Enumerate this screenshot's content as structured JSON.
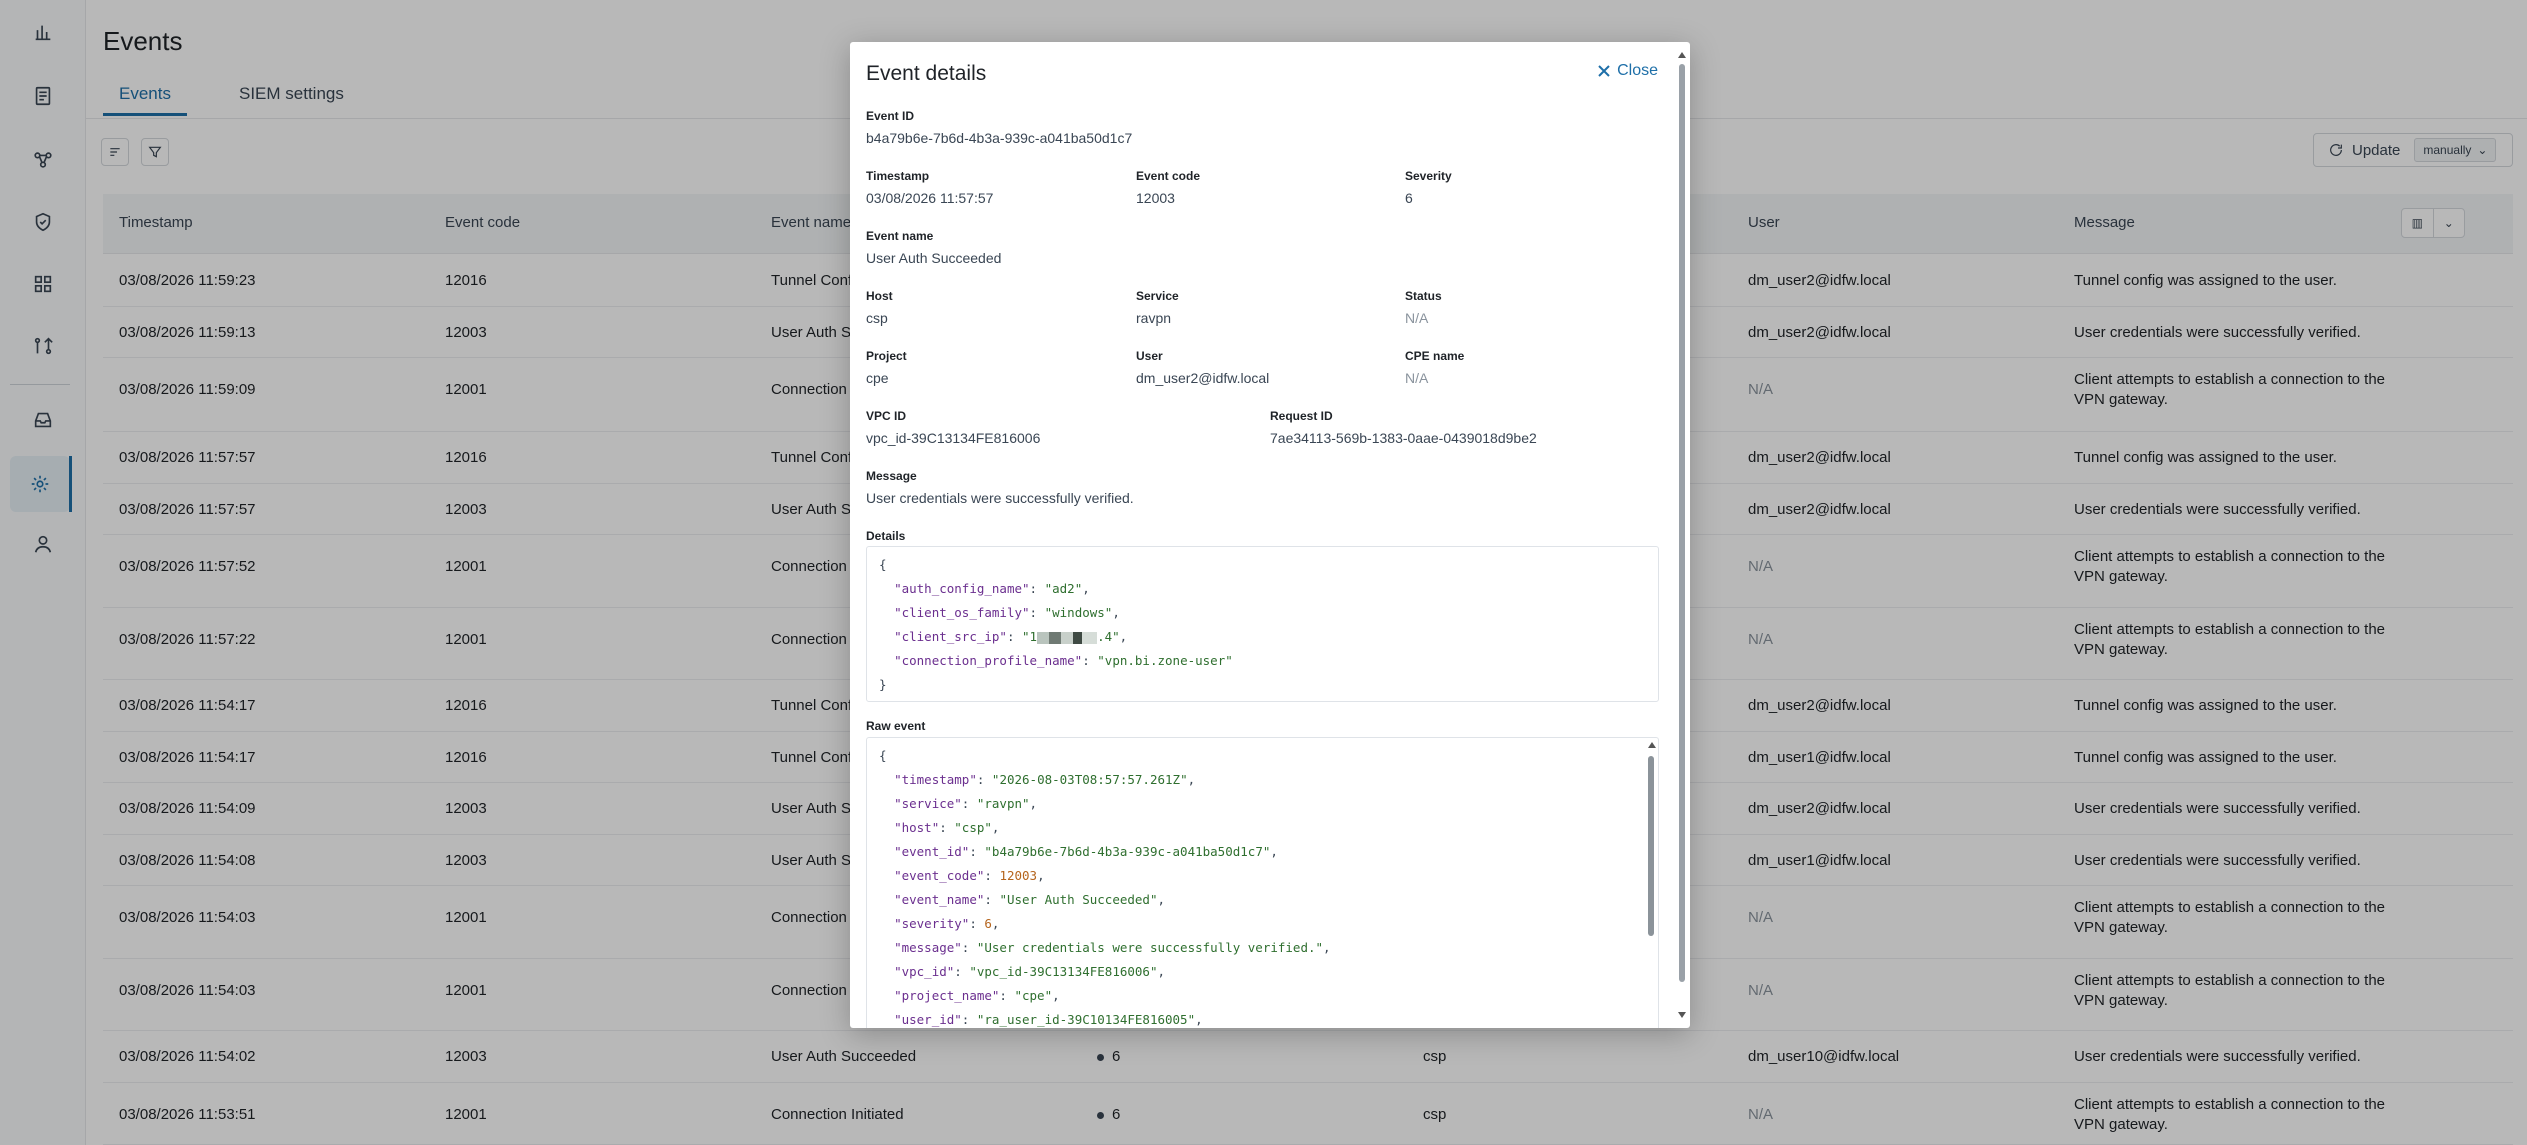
{
  "page": {
    "title": "Events",
    "tabs": [
      {
        "label": "Events",
        "active": true
      },
      {
        "label": "SIEM settings",
        "active": false
      }
    ],
    "update": {
      "label": "Update",
      "mode": "manually"
    }
  },
  "table": {
    "headers": {
      "timestamp": "Timestamp",
      "event_code": "Event code",
      "event_name": "Event name",
      "user": "User",
      "message": "Message"
    },
    "rows": [
      {
        "timestamp": "03/08/2026 11:59:23",
        "code": "12016",
        "name": "Tunnel Confi",
        "user": "dm_user2@idfw.local",
        "message": "Tunnel config was assigned to the user."
      },
      {
        "timestamp": "03/08/2026 11:59:13",
        "code": "12003",
        "name": "User Auth Su",
        "user": "dm_user2@idfw.local",
        "message": "User credentials were successfully verified."
      },
      {
        "timestamp": "03/08/2026 11:59:09",
        "code": "12001",
        "name": "Connection I",
        "user": "N/A",
        "message": "Client attempts to establish a connection to the VPN gateway."
      },
      {
        "timestamp": "03/08/2026 11:57:57",
        "code": "12016",
        "name": "Tunnel Confi",
        "user": "dm_user2@idfw.local",
        "message": "Tunnel config was assigned to the user."
      },
      {
        "timestamp": "03/08/2026 11:57:57",
        "code": "12003",
        "name": "User Auth Su",
        "user": "dm_user2@idfw.local",
        "message": "User credentials were successfully verified."
      },
      {
        "timestamp": "03/08/2026 11:57:52",
        "code": "12001",
        "name": "Connection I",
        "user": "N/A",
        "message": "Client attempts to establish a connection to the VPN gateway."
      },
      {
        "timestamp": "03/08/2026 11:57:22",
        "code": "12001",
        "name": "Connection I",
        "user": "N/A",
        "message": "Client attempts to establish a connection to the VPN gateway."
      },
      {
        "timestamp": "03/08/2026 11:54:17",
        "code": "12016",
        "name": "Tunnel Confi",
        "user": "dm_user2@idfw.local",
        "message": "Tunnel config was assigned to the user."
      },
      {
        "timestamp": "03/08/2026 11:54:17",
        "code": "12016",
        "name": "Tunnel Confi",
        "user": "dm_user1@idfw.local",
        "message": "Tunnel config was assigned to the user."
      },
      {
        "timestamp": "03/08/2026 11:54:09",
        "code": "12003",
        "name": "User Auth Su",
        "user": "dm_user2@idfw.local",
        "message": "User credentials were successfully verified."
      },
      {
        "timestamp": "03/08/2026 11:54:08",
        "code": "12003",
        "name": "User Auth Su",
        "user": "dm_user1@idfw.local",
        "message": "User credentials were successfully verified."
      },
      {
        "timestamp": "03/08/2026 11:54:03",
        "code": "12001",
        "name": "Connection I",
        "user": "N/A",
        "message": "Client attempts to establish a connection to the VPN gateway."
      },
      {
        "timestamp": "03/08/2026 11:54:03",
        "code": "12001",
        "name": "Connection I",
        "user": "N/A",
        "message": "Client attempts to establish a connection to the VPN gateway."
      },
      {
        "timestamp": "03/08/2026 11:54:02",
        "code": "12003",
        "name": "User Auth Succeeded",
        "severity": "6",
        "host": "csp",
        "user": "dm_user10@idfw.local",
        "message": "User credentials were successfully verified."
      },
      {
        "timestamp": "03/08/2026 11:53:51",
        "code": "12001",
        "name": "Connection Initiated",
        "severity": "6",
        "host": "csp",
        "user": "N/A",
        "message": "Client attempts to establish a connection to the VPN gateway."
      }
    ]
  },
  "modal": {
    "title": "Event details",
    "close_label": "Close",
    "fields": {
      "event_id": {
        "label": "Event ID",
        "value": "b4a79b6e-7b6d-4b3a-939c-a041ba50d1c7"
      },
      "timestamp": {
        "label": "Timestamp",
        "value": "03/08/2026 11:57:57"
      },
      "event_code": {
        "label": "Event code",
        "value": "12003"
      },
      "severity": {
        "label": "Severity",
        "value": "6"
      },
      "event_name": {
        "label": "Event name",
        "value": "User Auth Succeeded"
      },
      "host": {
        "label": "Host",
        "value": "csp"
      },
      "service": {
        "label": "Service",
        "value": "ravpn"
      },
      "status": {
        "label": "Status",
        "value": "N/A"
      },
      "project": {
        "label": "Project",
        "value": "cpe"
      },
      "user": {
        "label": "User",
        "value": "dm_user2@idfw.local"
      },
      "cpe_name": {
        "label": "CPE name",
        "value": "N/A"
      },
      "vpc_id": {
        "label": "VPC ID",
        "value": "vpc_id-39C13134FE816006"
      },
      "request_id": {
        "label": "Request ID",
        "value": "7ae34113-569b-1383-0aae-0439018d9be2"
      },
      "message": {
        "label": "Message",
        "value": "User credentials were successfully verified."
      }
    },
    "details_label": "Details",
    "details": {
      "auth_config_name": "\"ad2\"",
      "client_os_family": "\"windows\"",
      "client_src_ip_prefix": "\"1",
      "client_src_ip_suffix": ".4\"",
      "connection_profile_name": "\"vpn.bi.zone-user\""
    },
    "raw_event_label": "Raw event",
    "raw_event": {
      "timestamp": "\"2026-08-03T08:57:57.261Z\"",
      "service": "\"ravpn\"",
      "host": "\"csp\"",
      "event_id": "\"b4a79b6e-7b6d-4b3a-939c-a041ba50d1c7\"",
      "event_code": "12003",
      "event_name": "\"User Auth Succeeded\"",
      "severity": "6",
      "message": "\"User credentials were successfully verified.\"",
      "vpc_id": "\"vpc_id-39C13134FE816006\"",
      "project_name": "\"cpe\"",
      "user_id": "\"ra_user_id-39C10134FE816005\""
    }
  },
  "icons": [
    "bar-chart-icon",
    "document-list-icon",
    "network-icon",
    "shield-icon",
    "apps-grid-icon",
    "git-compare-icon",
    "inbox-icon",
    "gear-icon",
    "user-icon",
    "sort-icon",
    "filter-icon",
    "refresh-icon",
    "columns-icon",
    "chevron-down-icon",
    "close-icon"
  ],
  "colors": {
    "accent": "#1e6fa8",
    "na": "#8a939d"
  }
}
